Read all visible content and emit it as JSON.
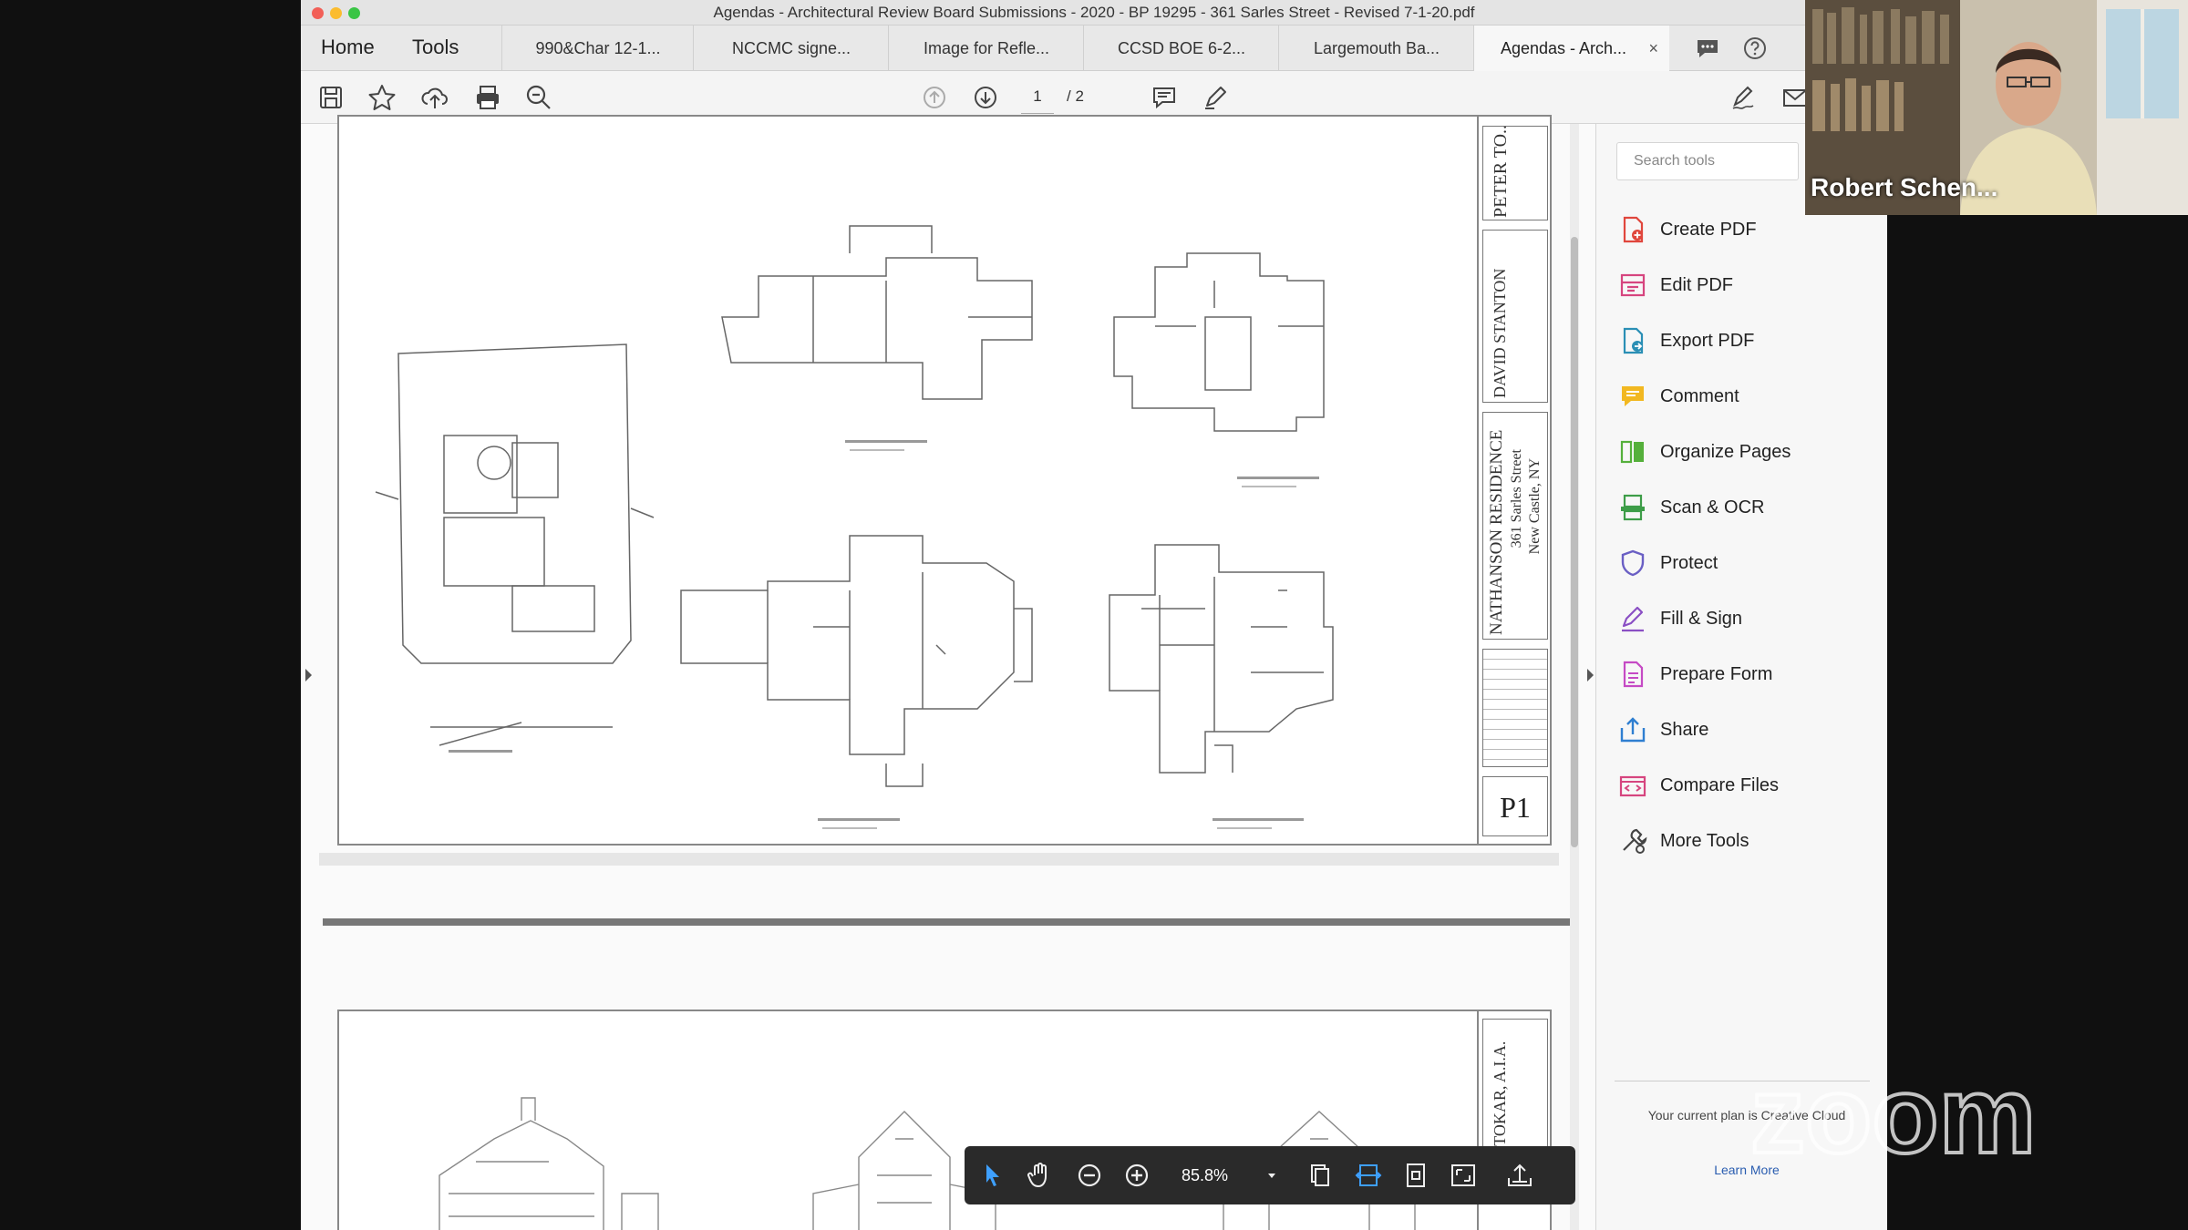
{
  "window": {
    "title": "Agendas - Architectural Review Board Submissions - 2020 - BP 19295 - 361 Sarles Street - Revised 7-1-20.pdf"
  },
  "nav_tabs": {
    "home": "Home",
    "tools": "Tools"
  },
  "doc_tabs": [
    {
      "label": "990&Char 12-1..."
    },
    {
      "label": "NCCMC signe..."
    },
    {
      "label": "Image for Refle..."
    },
    {
      "label": "CCSD BOE 6-2..."
    },
    {
      "label": "Largemouth Ba..."
    },
    {
      "label": "Agendas - Arch...",
      "close": "×"
    }
  ],
  "toolbar": {
    "page_current": "1",
    "page_total": "/ 2"
  },
  "sheet1": {
    "title_block": {
      "architect": "PETER TO...",
      "designer": "DAVID STANTON",
      "project_name": "NATHANSON RESIDENCE",
      "address_line1": "361 Sarles Street",
      "address_line2": "New Castle, NY",
      "sheet_number": "P1"
    }
  },
  "sheet2": {
    "title_block": {
      "architect": "PETER TOKAR, A.I.A."
    }
  },
  "tools_panel": {
    "search_placeholder": "Search tools",
    "items": [
      {
        "label": "Create PDF",
        "icon": "create-pdf-icon",
        "color": "#e0463c"
      },
      {
        "label": "Edit PDF",
        "icon": "edit-pdf-icon",
        "color": "#d6457f"
      },
      {
        "label": "Export PDF",
        "icon": "export-pdf-icon",
        "color": "#2a8fb5"
      },
      {
        "label": "Comment",
        "icon": "comment-icon",
        "color": "#f2b821"
      },
      {
        "label": "Organize Pages",
        "icon": "organize-pages-icon",
        "color": "#55b03b"
      },
      {
        "label": "Scan & OCR",
        "icon": "scan-ocr-icon",
        "color": "#3d9d48"
      },
      {
        "label": "Protect",
        "icon": "protect-icon",
        "color": "#6a5fc4"
      },
      {
        "label": "Fill & Sign",
        "icon": "fill-sign-icon",
        "color": "#8a4fc4"
      },
      {
        "label": "Prepare Form",
        "icon": "prepare-form-icon",
        "color": "#c54ac4"
      },
      {
        "label": "Share",
        "icon": "share-icon",
        "color": "#2f7fd1"
      },
      {
        "label": "Compare Files",
        "icon": "compare-files-icon",
        "color": "#d6457f"
      },
      {
        "label": "More Tools",
        "icon": "more-tools-icon",
        "color": "#444444"
      }
    ],
    "plan_text": "Your current plan is Creative Cloud",
    "learn_more": "Learn More"
  },
  "floating_toolbar": {
    "zoom_level": "85.8%"
  },
  "webcam": {
    "participant_name": "Robert Schen..."
  },
  "zoom_watermark": "zoom"
}
